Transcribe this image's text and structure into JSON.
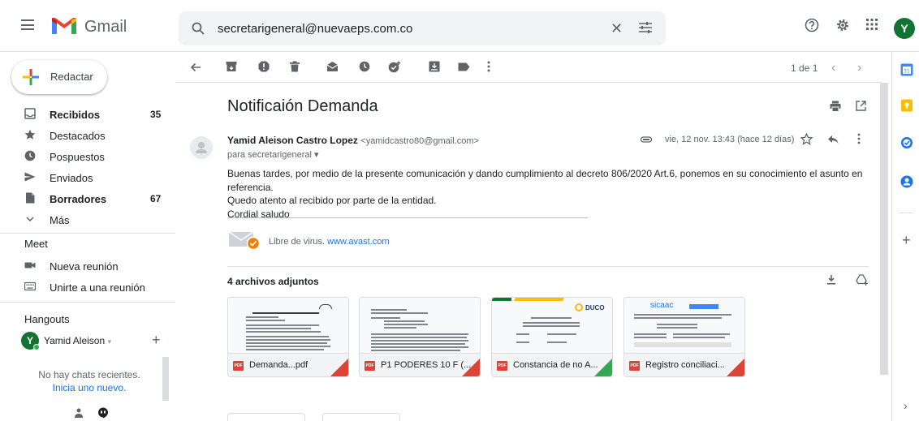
{
  "app": {
    "name": "Gmail"
  },
  "search": {
    "value": "secretarigeneral@nuevaeps.com.co"
  },
  "user": {
    "avatar_letter": "Y"
  },
  "sidebar": {
    "compose_label": "Redactar",
    "items": [
      {
        "label": "Recibidos",
        "count": "35"
      },
      {
        "label": "Destacados",
        "count": ""
      },
      {
        "label": "Pospuestos",
        "count": ""
      },
      {
        "label": "Enviados",
        "count": ""
      },
      {
        "label": "Borradores",
        "count": "67"
      },
      {
        "label": "Más",
        "count": ""
      }
    ],
    "meet": {
      "title": "Meet",
      "items": [
        {
          "label": "Nueva reunión"
        },
        {
          "label": "Unirte a una reunión"
        }
      ]
    },
    "hangouts": {
      "title": "Hangouts",
      "user_name": "Yamid Aleison",
      "avatar_letter": "Y",
      "no_chats": "No hay chats recientes.",
      "start_link": "Inicia uno nuevo."
    }
  },
  "toolbar": {
    "pager": "1 de 1"
  },
  "message": {
    "subject": "Notificaión Demanda",
    "sender_name": "Yamid Aleison Castro Lopez",
    "sender_email": "<yamidcastro80@gmail.com>",
    "recipient": "para secretarigeneral",
    "date": "vie, 12 nov. 13:43 (hace 12 días)",
    "body": [
      "Buenas tardes, por medio de la presente comunicación y dando cumplimiento al decreto 806/2020 Art.6, ponemos en su conocimiento el asunto en referencia.",
      "Quedo atento al recibido por parte de la entidad.",
      "Cordial saludo"
    ],
    "avast_text": "Libre de virus.",
    "avast_link": "www.avast.com"
  },
  "attachments": {
    "title": "4 archivos adjuntos",
    "files": [
      {
        "name": "Demanda...pdf",
        "badge": "PDF"
      },
      {
        "name": "P1 PODERES 10 F (...",
        "badge": "PDF"
      },
      {
        "name": "Constancia de no A...",
        "badge": "PDF"
      },
      {
        "name": "Registro conciliaci...",
        "badge": "PDF"
      }
    ],
    "thumb3_logo": "DUCO",
    "thumb4_logo": "sicaac"
  },
  "colors": {
    "accent": "#1a73e8",
    "gmail_red": "#ea4335",
    "pdf_red": "#db4437",
    "avatar_green": "#137333"
  }
}
